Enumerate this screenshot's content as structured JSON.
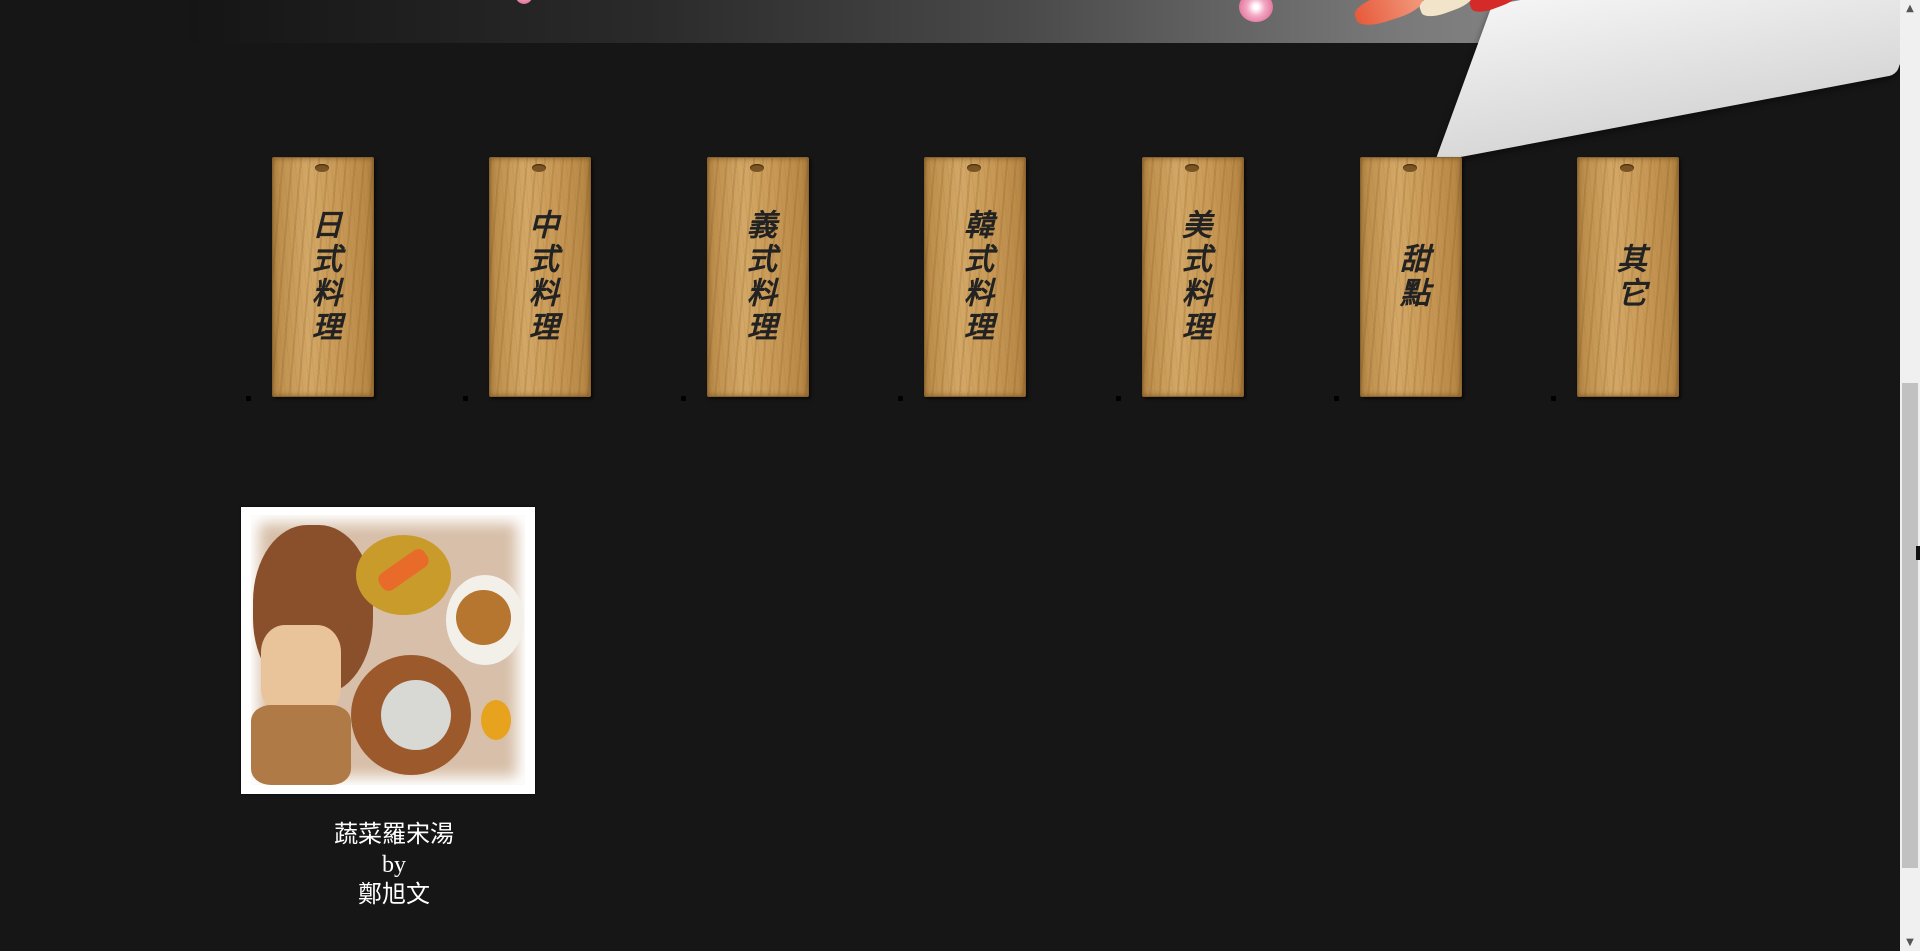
{
  "categories": [
    {
      "label": "日式料理"
    },
    {
      "label": "中式料理"
    },
    {
      "label": "義式料理"
    },
    {
      "label": "韓式料理"
    },
    {
      "label": "美式料理"
    },
    {
      "label": "甜點"
    },
    {
      "label": "其它"
    }
  ],
  "recipe": {
    "title": "蔬菜羅宋湯",
    "by": "by",
    "author": "鄭旭文"
  },
  "scrollbar": {
    "up_arrow": "▲",
    "down_arrow": "▼"
  }
}
